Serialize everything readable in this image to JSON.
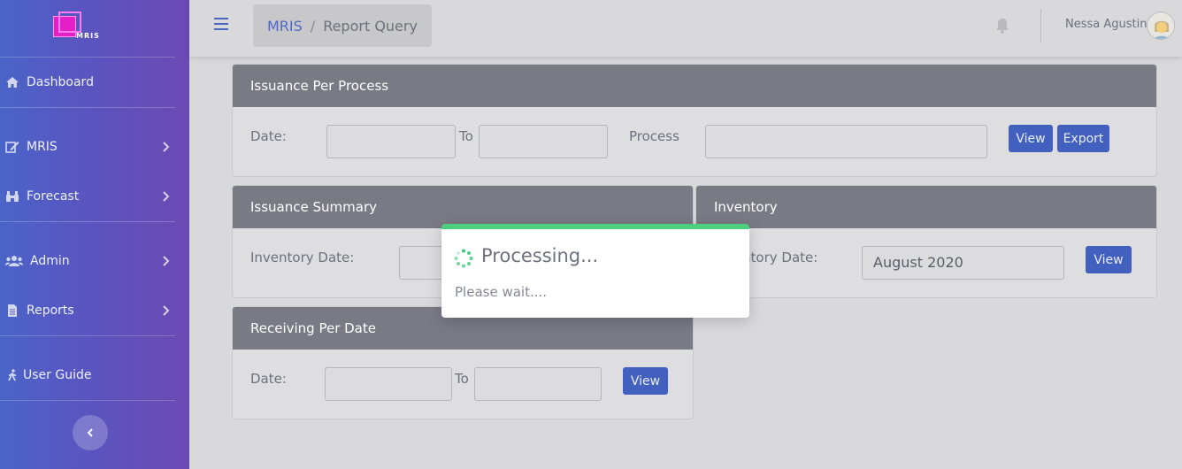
{
  "brand": {
    "logo_text": "MRIS"
  },
  "sidebar": {
    "items": [
      {
        "label": "Dashboard"
      },
      {
        "label": "MRIS"
      },
      {
        "label": "Forecast"
      },
      {
        "label": "Admin"
      },
      {
        "label": "Reports"
      },
      {
        "label": "User Guide"
      }
    ]
  },
  "topbar": {
    "breadcrumb": {
      "root": "MRIS",
      "separator": "/",
      "current": "Report Query"
    },
    "user_name": "Nessa Agustin"
  },
  "cards": {
    "issuance_per_process": {
      "title": "Issuance Per Process",
      "date_label": "Date:",
      "to_label": "To",
      "process_label": "Process",
      "date_from": "",
      "date_to": "",
      "process": "",
      "view_label": "View",
      "export_label": "Export"
    },
    "issuance_summary": {
      "title": "Issuance Summary",
      "inventory_date_label": "Inventory Date:",
      "inventory_date": ""
    },
    "inventory": {
      "title": "Inventory",
      "inventory_date_label": "Inventory Date:",
      "inventory_date": "August 2020",
      "view_label": "View"
    },
    "receiving_per_date": {
      "title": "Receiving Per Date",
      "date_label": "Date:",
      "to_label": "To",
      "date_from": "",
      "date_to": "",
      "view_label": "View"
    }
  },
  "modal": {
    "title": "Processing...",
    "message": "Please wait...."
  },
  "colors": {
    "accent": "#4261bf",
    "card_header": "#7a7a85",
    "modal_bar": "#4cd07d"
  }
}
